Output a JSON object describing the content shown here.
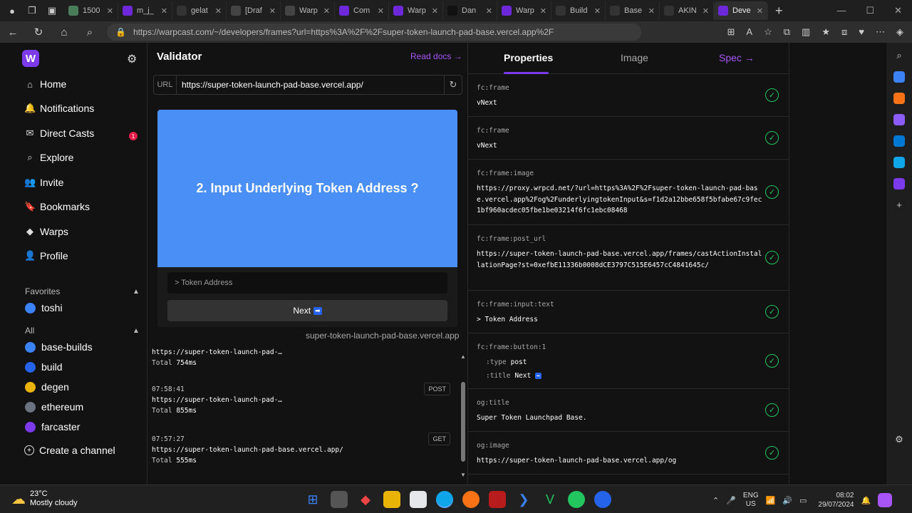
{
  "browser": {
    "tabs": [
      {
        "label": "1500",
        "color": "#4a7c59"
      },
      {
        "label": "m_j_",
        "color": "#6d28d9"
      },
      {
        "label": "gelat",
        "color": "#333333"
      },
      {
        "label": "[Draf",
        "color": "#444444"
      },
      {
        "label": "Warp",
        "color": "#444444"
      },
      {
        "label": "Com",
        "color": "#6d28d9"
      },
      {
        "label": "Warp",
        "color": "#6d28d9"
      },
      {
        "label": "Dan",
        "color": "#111111"
      },
      {
        "label": "Warp",
        "color": "#6d28d9"
      },
      {
        "label": "Build",
        "color": "#333333"
      },
      {
        "label": "Base",
        "color": "#333333"
      },
      {
        "label": "AKIN",
        "color": "#333333"
      },
      {
        "label": "Deve",
        "color": "#6d28d9"
      }
    ],
    "url": "https://warpcast.com/~/developers/frames?url=https%3A%2F%2Fsuper-token-launch-pad-base.vercel.app%2F"
  },
  "nav": {
    "logo": "W",
    "items": [
      {
        "label": "Home",
        "icon": "⌂"
      },
      {
        "label": "Notifications",
        "icon": "🔔"
      },
      {
        "label": "Direct Casts",
        "icon": "✉"
      },
      {
        "label": "Explore",
        "icon": "⌕"
      },
      {
        "label": "Invite",
        "icon": "👥"
      },
      {
        "label": "Bookmarks",
        "icon": "🔖"
      },
      {
        "label": "Warps",
        "icon": "◆"
      },
      {
        "label": "Profile",
        "icon": "👤"
      }
    ],
    "dc_badge": "1",
    "favorites_label": "Favorites",
    "favorites": [
      {
        "label": "toshi",
        "color": "#3b82f6"
      }
    ],
    "all_label": "All",
    "channels": [
      {
        "label": "base-builds",
        "color": "#3b82f6"
      },
      {
        "label": "build",
        "color": "#2563eb"
      },
      {
        "label": "degen",
        "color": "#eab308"
      },
      {
        "label": "ethereum",
        "color": "#6b7280"
      },
      {
        "label": "farcaster",
        "color": "#7c3aed"
      }
    ],
    "create_channel": "Create a channel"
  },
  "validator": {
    "title": "Validator",
    "read_docs": "Read docs →",
    "url_label": "URL",
    "url_value": "https://super-token-launch-pad-base.vercel.app/",
    "frame_heading": "2. Input Underlying Token  Address ?",
    "input_placeholder": "> Token Address",
    "button_label": "Next",
    "button_emoji": "➡",
    "domain": "super-token-launch-pad-base.vercel.app",
    "logs": [
      {
        "time": "",
        "url": "https://super-token-launch-pad-…",
        "total_label": "Total",
        "total": "754ms",
        "method": ""
      },
      {
        "time": "07:58:41",
        "url": "https://super-token-launch-pad-…",
        "total_label": "Total",
        "total": "855ms",
        "method": "POST"
      },
      {
        "time": "07:57:27",
        "url": "https://super-token-launch-pad-base.vercel.app/",
        "total_label": "Total",
        "total": "555ms",
        "method": "GET"
      }
    ]
  },
  "properties": {
    "tabs": {
      "properties": "Properties",
      "image": "Image",
      "spec": "Spec →"
    },
    "rows": [
      {
        "key": "fc:frame",
        "value": "vNext"
      },
      {
        "key": "fc:frame",
        "value": "vNext"
      },
      {
        "key": "fc:frame:image",
        "value": "https://proxy.wrpcd.net/?url=https%3A%2F%2Fsuper-token-launch-pad-base.vercel.app%2Fog%2FunderlyingtokenInput&s=f1d2a12bbe658f5bfabe67c9fec1bf960acdec05fbe1be03214f6fc1ebc08468"
      },
      {
        "key": "fc:frame:post_url",
        "value": "https://super-token-launch-pad-base.vercel.app/frames/castActionInstallationPage?st=0xefbE11336b0008dCE3797C515E6457cC4841645c/"
      },
      {
        "key": "fc:frame:input:text",
        "value": "> Token Address"
      },
      {
        "key": "fc:frame:button:1",
        "value": ""
      },
      {
        "key": "og:title",
        "value": "Super Token Launchpad Base."
      },
      {
        "key": "og:image",
        "value": "https://super-token-launch-pad-base.vercel.app/og"
      }
    ],
    "button_type_key": ":type",
    "button_type_val": "post",
    "button_title_key": ":title",
    "button_title_val": "Next",
    "check_glyph": "✓"
  },
  "taskbar": {
    "temp": "23°C",
    "weather": "Mostly cloudy",
    "lang1": "ENG",
    "lang2": "US",
    "time": "08:02",
    "date": "29/07/2024"
  }
}
